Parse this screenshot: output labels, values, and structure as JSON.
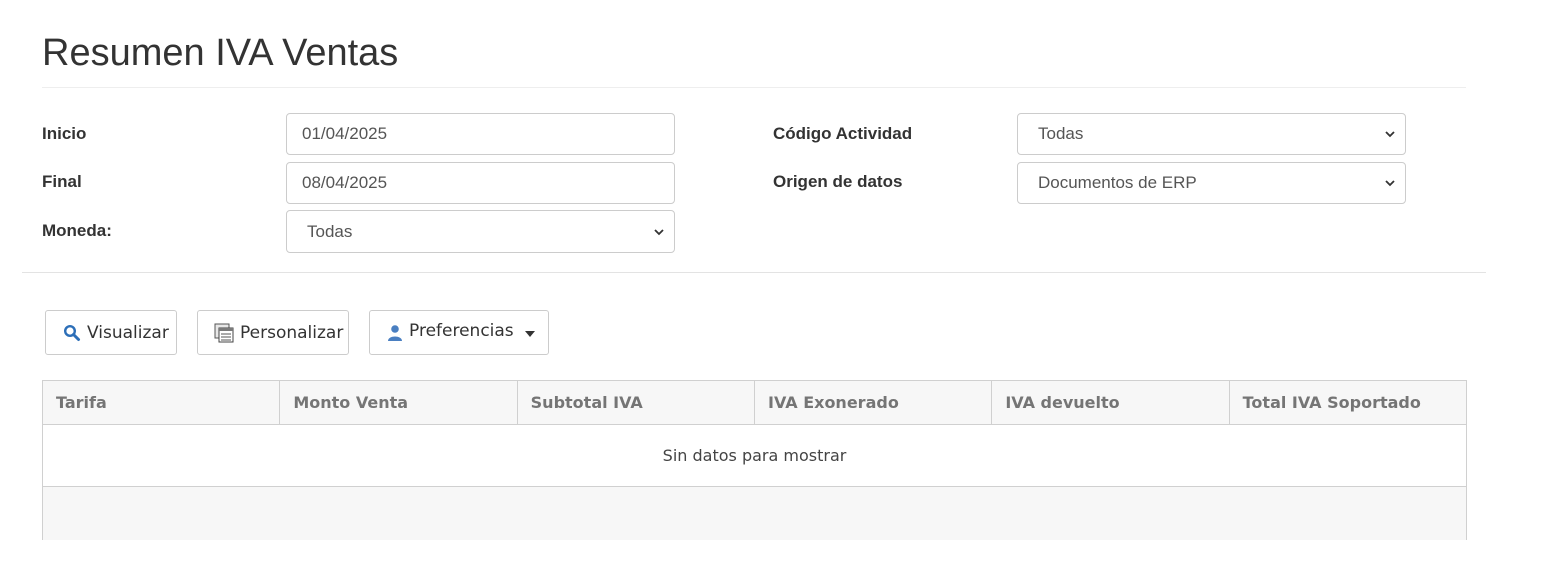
{
  "page": {
    "title": "Resumen IVA Ventas"
  },
  "filters": {
    "inicio": {
      "label": "Inicio",
      "value": "01/04/2025"
    },
    "final": {
      "label": "Final",
      "value": "08/04/2025"
    },
    "moneda": {
      "label": "Moneda:",
      "value": "Todas"
    },
    "codigo_actividad": {
      "label": "Código Actividad",
      "value": "Todas"
    },
    "origen_datos": {
      "label": "Origen de datos",
      "value": "Documentos de ERP"
    }
  },
  "toolbar": {
    "visualizar": "Visualizar",
    "personalizar": "Personalizar",
    "preferencias": "Preferencias"
  },
  "grid": {
    "columns": [
      "Tarifa",
      "Monto Venta",
      "Subtotal IVA",
      "IVA Exonerado",
      "IVA devuelto",
      "Total IVA Soportado"
    ],
    "empty_message": "Sin datos para mostrar"
  },
  "colors": {
    "search_icon": "#2d6fb8",
    "user_icon": "#4a7fc1",
    "border": "#cccccc"
  },
  "icons": [
    "search-icon",
    "customize-grid-icon",
    "user-icon",
    "caret-down-icon",
    "chevron-down-icon"
  ]
}
